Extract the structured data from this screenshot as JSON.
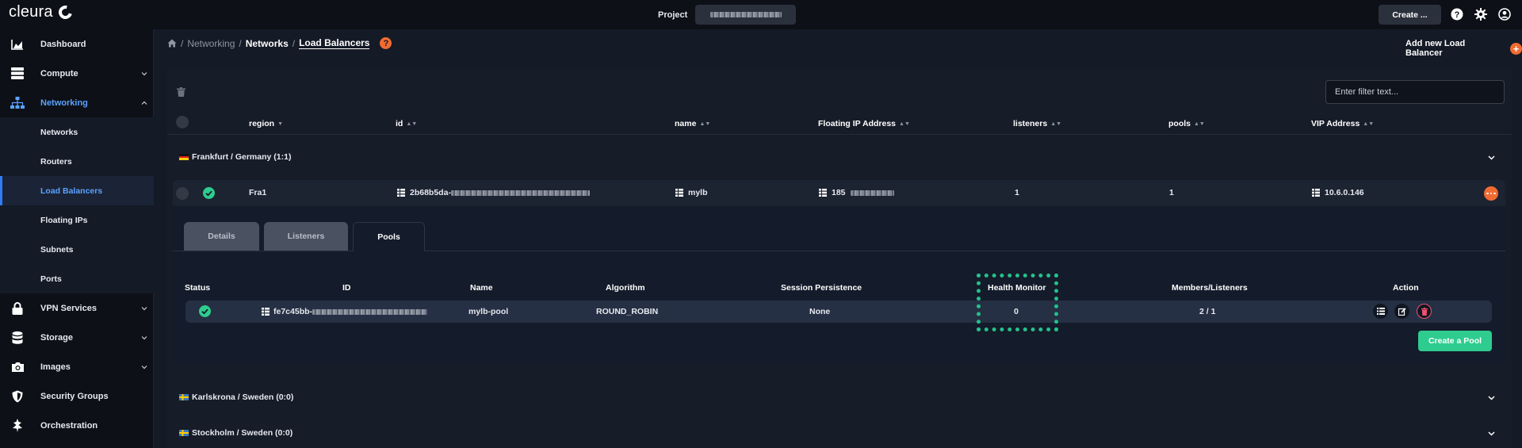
{
  "app": {
    "brand": "cleura"
  },
  "topbar": {
    "project_label": "Project",
    "create_label": "Create ..."
  },
  "sidebar": {
    "items": [
      {
        "label": "Dashboard"
      },
      {
        "label": "Compute"
      },
      {
        "label": "Networking"
      },
      {
        "label": "Networks"
      },
      {
        "label": "Routers"
      },
      {
        "label": "Load Balancers"
      },
      {
        "label": "Floating IPs"
      },
      {
        "label": "Subnets"
      },
      {
        "label": "Ports"
      },
      {
        "label": "VPN Services"
      },
      {
        "label": "Storage"
      },
      {
        "label": "Images"
      },
      {
        "label": "Security Groups"
      },
      {
        "label": "Orchestration"
      }
    ]
  },
  "breadcrumb": {
    "sep": "/",
    "networking": "Networking",
    "networks": "Networks",
    "current": "Load Balancers"
  },
  "header": {
    "help": "?",
    "add_label": "Add new Load Balancer",
    "add_icon": "+"
  },
  "filter": {
    "placeholder": "Enter filter text..."
  },
  "table": {
    "columns": [
      "region",
      "id",
      "name",
      "Floating IP Address",
      "listeners",
      "pools",
      "VIP Address"
    ],
    "sort_asc_desc": "▲▼",
    "sort_desc": "▼"
  },
  "groups": [
    {
      "label": "Frankfurt / Germany (1:1)"
    },
    {
      "label": "Karlskrona / Sweden (0:0)"
    },
    {
      "label": "Stockholm / Sweden (0:0)"
    }
  ],
  "loadbalancer": {
    "region": "Fra1",
    "id_prefix": "2b68b5da-",
    "name": "mylb",
    "floating_ip_prefix": "185",
    "listeners": "1",
    "pools": "1",
    "vip": "10.6.0.146"
  },
  "tabs": [
    "Details",
    "Listeners",
    "Pools"
  ],
  "pools_table": {
    "columns": [
      "Status",
      "ID",
      "Name",
      "Algorithm",
      "Session Persistence",
      "Health Monitor",
      "Members/Listeners",
      "Action"
    ],
    "row": {
      "id_prefix": "fe7c45bb-",
      "name": "mylb-pool",
      "algorithm": "ROUND_ROBIN",
      "session_persistence": "None",
      "health_monitor": "0",
      "members_listeners": "2 / 1"
    },
    "create_label": "Create a Pool"
  },
  "colors": {
    "accent": "#f06b32",
    "active": "#5aa2ff",
    "success": "#2ecc8f"
  }
}
